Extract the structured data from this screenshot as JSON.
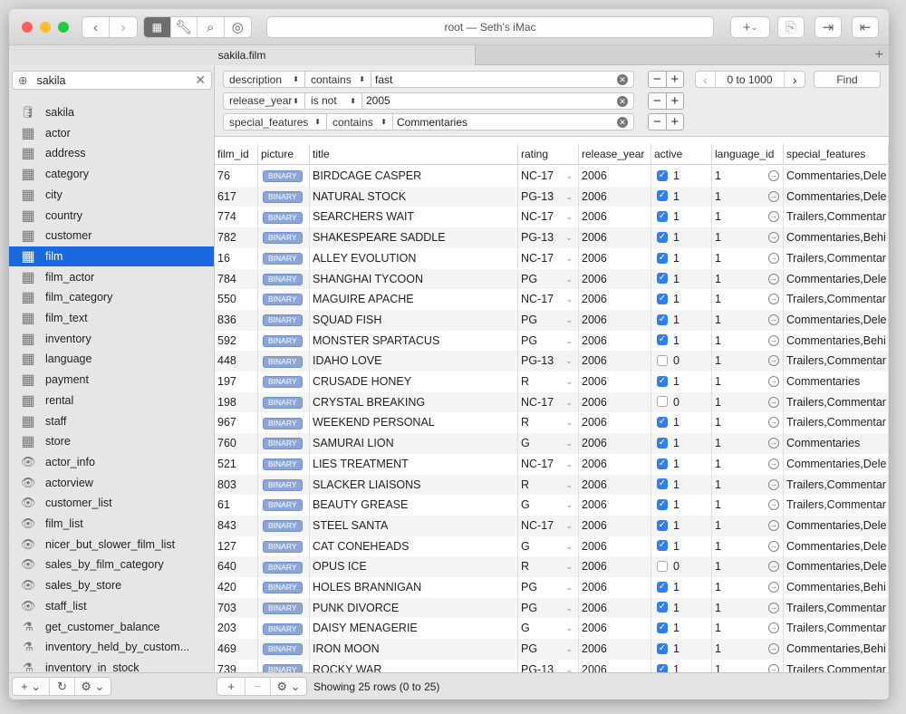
{
  "window": {
    "title": "root — Seth's iMac",
    "tab": "sakila.film"
  },
  "sidebar": {
    "filter_value": "sakila",
    "items": [
      {
        "label": "sakila",
        "icon": "database"
      },
      {
        "label": "actor",
        "icon": "table"
      },
      {
        "label": "address",
        "icon": "table"
      },
      {
        "label": "category",
        "icon": "table"
      },
      {
        "label": "city",
        "icon": "table"
      },
      {
        "label": "country",
        "icon": "table"
      },
      {
        "label": "customer",
        "icon": "table"
      },
      {
        "label": "film",
        "icon": "table",
        "selected": true
      },
      {
        "label": "film_actor",
        "icon": "table"
      },
      {
        "label": "film_category",
        "icon": "table"
      },
      {
        "label": "film_text",
        "icon": "table"
      },
      {
        "label": "inventory",
        "icon": "table"
      },
      {
        "label": "language",
        "icon": "table"
      },
      {
        "label": "payment",
        "icon": "table"
      },
      {
        "label": "rental",
        "icon": "table"
      },
      {
        "label": "staff",
        "icon": "table"
      },
      {
        "label": "store",
        "icon": "table"
      },
      {
        "label": "actor_info",
        "icon": "view"
      },
      {
        "label": "actorview",
        "icon": "view"
      },
      {
        "label": "customer_list",
        "icon": "view"
      },
      {
        "label": "film_list",
        "icon": "view"
      },
      {
        "label": "nicer_but_slower_film_list",
        "icon": "view"
      },
      {
        "label": "sales_by_film_category",
        "icon": "view"
      },
      {
        "label": "sales_by_store",
        "icon": "view"
      },
      {
        "label": "staff_list",
        "icon": "view"
      },
      {
        "label": "get_customer_balance",
        "icon": "function"
      },
      {
        "label": "inventory_held_by_custom...",
        "icon": "function"
      },
      {
        "label": "inventory_in_stock",
        "icon": "function"
      }
    ]
  },
  "filters": [
    {
      "field": "description",
      "op": "contains",
      "value": "fast"
    },
    {
      "field": "release_year",
      "op": "is not",
      "value": "2005"
    },
    {
      "field": "special_features",
      "op": "contains",
      "value": "Commentaries"
    }
  ],
  "pagination": {
    "range": "0 to 1000",
    "find_label": "Find"
  },
  "table": {
    "columns": [
      "film_id",
      "picture",
      "title",
      "rating",
      "release_year",
      "active",
      "language_id",
      "special_features"
    ],
    "binary_label": "BINARY",
    "rows": [
      [
        "76",
        "BIRDCAGE CASPER",
        "NC-17",
        "2006",
        1,
        "1",
        "Commentaries,Dele"
      ],
      [
        "617",
        "NATURAL STOCK",
        "PG-13",
        "2006",
        1,
        "1",
        "Commentaries,Dele"
      ],
      [
        "774",
        "SEARCHERS WAIT",
        "NC-17",
        "2006",
        1,
        "1",
        "Trailers,Commentar"
      ],
      [
        "782",
        "SHAKESPEARE SADDLE",
        "PG-13",
        "2006",
        1,
        "1",
        "Commentaries,Behi"
      ],
      [
        "16",
        "ALLEY EVOLUTION",
        "NC-17",
        "2006",
        1,
        "1",
        "Trailers,Commentar"
      ],
      [
        "784",
        "SHANGHAI TYCOON",
        "PG",
        "2006",
        1,
        "1",
        "Commentaries,Dele"
      ],
      [
        "550",
        "MAGUIRE APACHE",
        "NC-17",
        "2006",
        1,
        "1",
        "Trailers,Commentar"
      ],
      [
        "836",
        "SQUAD FISH",
        "PG",
        "2006",
        1,
        "1",
        "Commentaries,Dele"
      ],
      [
        "592",
        "MONSTER SPARTACUS",
        "PG",
        "2006",
        1,
        "1",
        "Commentaries,Behi"
      ],
      [
        "448",
        "IDAHO LOVE",
        "PG-13",
        "2006",
        0,
        "1",
        "Trailers,Commentar"
      ],
      [
        "197",
        "CRUSADE HONEY",
        "R",
        "2006",
        1,
        "1",
        "Commentaries"
      ],
      [
        "198",
        "CRYSTAL BREAKING",
        "NC-17",
        "2006",
        0,
        "1",
        "Trailers,Commentar"
      ],
      [
        "967",
        "WEEKEND PERSONAL",
        "R",
        "2006",
        1,
        "1",
        "Trailers,Commentar"
      ],
      [
        "760",
        "SAMURAI LION",
        "G",
        "2006",
        1,
        "1",
        "Commentaries"
      ],
      [
        "521",
        "LIES TREATMENT",
        "NC-17",
        "2006",
        1,
        "1",
        "Commentaries,Dele"
      ],
      [
        "803",
        "SLACKER LIAISONS",
        "R",
        "2006",
        1,
        "1",
        "Trailers,Commentar"
      ],
      [
        "61",
        "BEAUTY GREASE",
        "G",
        "2006",
        1,
        "1",
        "Trailers,Commentar"
      ],
      [
        "843",
        "STEEL SANTA",
        "NC-17",
        "2006",
        1,
        "1",
        "Commentaries,Dele"
      ],
      [
        "127",
        "CAT CONEHEADS",
        "G",
        "2006",
        1,
        "1",
        "Commentaries,Dele"
      ],
      [
        "640",
        "OPUS ICE",
        "R",
        "2006",
        0,
        "1",
        "Commentaries,Dele"
      ],
      [
        "420",
        "HOLES BRANNIGAN",
        "PG",
        "2006",
        1,
        "1",
        "Commentaries,Behi"
      ],
      [
        "703",
        "PUNK DIVORCE",
        "PG",
        "2006",
        1,
        "1",
        "Trailers,Commentar"
      ],
      [
        "203",
        "DAISY MENAGERIE",
        "G",
        "2006",
        1,
        "1",
        "Trailers,Commentar"
      ],
      [
        "469",
        "IRON MOON",
        "PG",
        "2006",
        1,
        "1",
        "Commentaries,Behi"
      ],
      [
        "739",
        "ROCKY WAR",
        "PG-13",
        "2006",
        1,
        "1",
        "Trailers,Commentar"
      ]
    ]
  },
  "status": "Showing 25 rows (0 to 25)",
  "colors": {
    "selection": "#1a69e0",
    "binary_badge": "#8aa6d8",
    "checkbox": "#2f7ef2"
  }
}
